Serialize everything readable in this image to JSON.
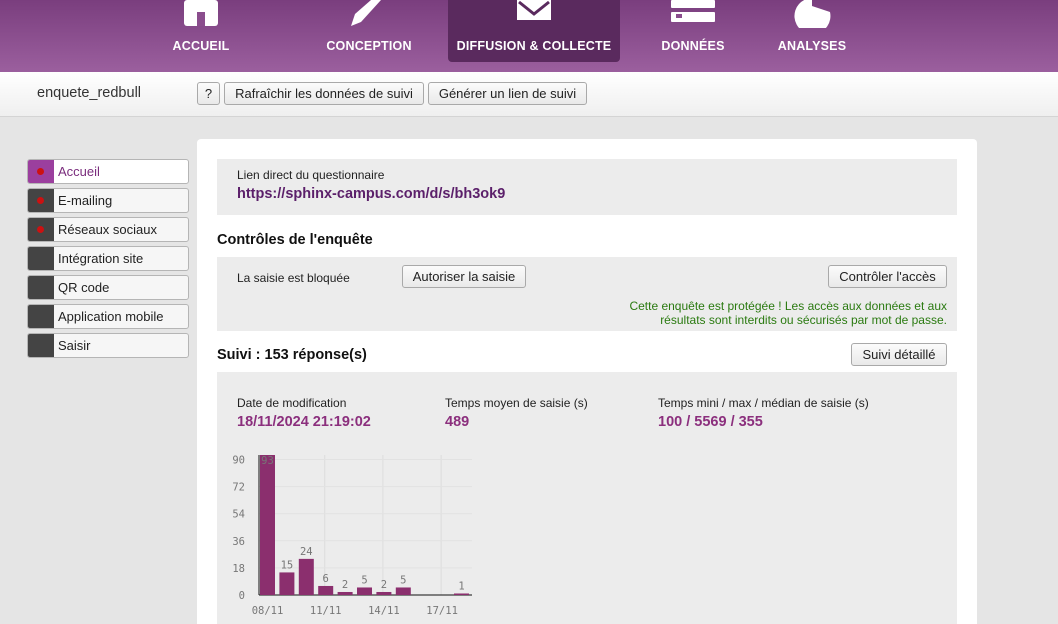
{
  "nav": {
    "items": [
      {
        "label": "ACCUEIL",
        "icon": "home-icon"
      },
      {
        "label": "CONCEPTION",
        "icon": "pencil-icon"
      },
      {
        "label": "DIFFUSION & COLLECTE",
        "icon": "envelope-icon"
      },
      {
        "label": "DONNÉES",
        "icon": "database-icon"
      },
      {
        "label": "ANALYSES",
        "icon": "pie-chart-icon"
      }
    ],
    "active": "DIFFUSION & COLLECTE"
  },
  "subbar": {
    "survey_name": "enquete_redbull",
    "help_label": "?",
    "refresh_label": "Rafraîchir les données de suivi",
    "generate_link_label": "Générer un lien de suivi"
  },
  "sidebar": {
    "items": [
      {
        "label": "Accueil",
        "dot": true,
        "active": true
      },
      {
        "label": "E-mailing",
        "dot": true
      },
      {
        "label": "Réseaux sociaux",
        "dot": true
      },
      {
        "label": "Intégration site",
        "dot": false
      },
      {
        "label": "QR code",
        "dot": false
      },
      {
        "label": "Application mobile",
        "dot": false
      },
      {
        "label": "Saisir",
        "dot": false
      }
    ]
  },
  "direct_link": {
    "label": "Lien direct du questionnaire",
    "url": "https://sphinx-campus.com/d/s/bh3ok9"
  },
  "controls": {
    "title": "Contrôles de l'enquête",
    "status_text": "La saisie est bloquée",
    "allow_button": "Autoriser la saisie",
    "access_button": "Contrôler l'accès",
    "warning_line1": "Cette enquête est protégée ! Les accès aux données et aux",
    "warning_line2": "résultats sont interdits ou sécurisés par mot de passe."
  },
  "tracking": {
    "title": "Suivi : 153 réponse(s)",
    "detail_button": "Suivi détaillé",
    "stats": [
      {
        "label": "Date de modification",
        "value": "18/11/2024 21:19:02"
      },
      {
        "label": "Temps moyen de saisie (s)",
        "value": "489"
      },
      {
        "label": "Temps mini / max / médian de saisie (s)",
        "value": "100 / 5569 / 355"
      }
    ]
  },
  "chart_data": {
    "type": "bar",
    "x": [
      "08/11",
      "09/11",
      "10/11",
      "11/11",
      "12/11",
      "13/11",
      "14/11",
      "15/11",
      "16/11",
      "17/11",
      "18/11"
    ],
    "values": [
      93,
      15,
      24,
      6,
      2,
      5,
      2,
      5,
      0,
      0,
      1
    ],
    "value_labels": [
      "93",
      "15",
      "24",
      "6",
      "2",
      "5",
      "2",
      "5",
      "",
      "",
      "1"
    ],
    "x_tick_labels": [
      "08/11",
      "11/11",
      "14/11",
      "17/11"
    ],
    "y_ticks": [
      0,
      18,
      36,
      54,
      72,
      90
    ],
    "ylim": [
      0,
      93
    ],
    "bar_color": "#8b2f6e",
    "grid": true
  }
}
